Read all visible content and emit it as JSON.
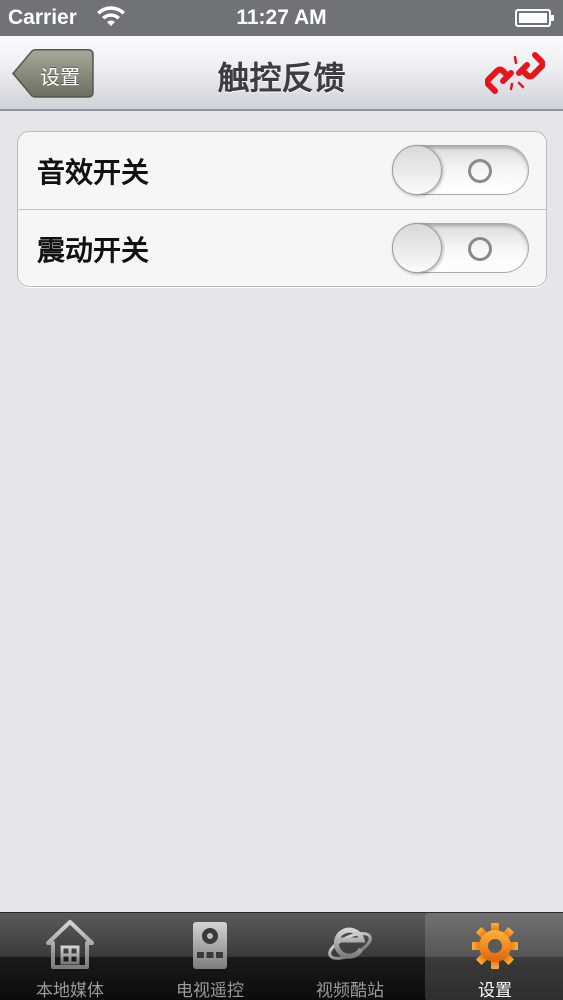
{
  "status_bar": {
    "carrier": "Carrier",
    "time": "11:27 AM",
    "wifi_icon": "wifi-icon",
    "battery_icon": "battery-icon"
  },
  "nav_bar": {
    "back_label": "设置",
    "title": "触控反馈",
    "right_icon": "broken-link-icon",
    "right_icon_color": "#e8141c"
  },
  "settings": {
    "rows": [
      {
        "label": "音效开关",
        "state": "off"
      },
      {
        "label": "震动开关",
        "state": "off"
      }
    ]
  },
  "tab_bar": {
    "selected": "设置",
    "accent_color": "#f28a1a",
    "tabs": [
      {
        "label": "本地媒体",
        "icon": "home-icon"
      },
      {
        "label": "电视遥控",
        "icon": "remote-control-icon"
      },
      {
        "label": "视频酷站",
        "icon": "browser-e-icon"
      },
      {
        "label": "设置",
        "icon": "gear-icon"
      }
    ]
  }
}
